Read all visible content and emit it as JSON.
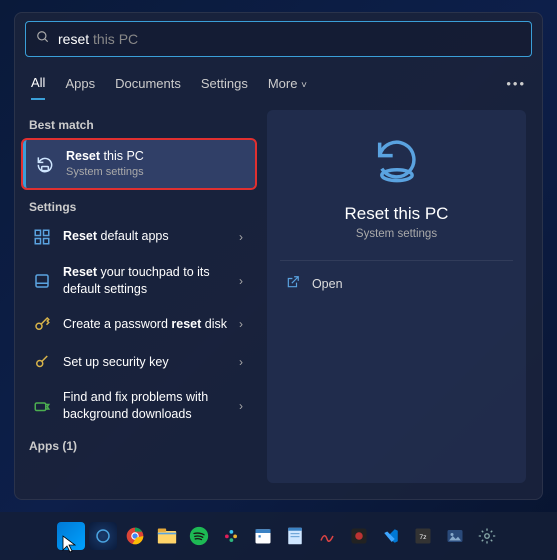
{
  "search": {
    "typed": "reset",
    "suggestion": " this PC"
  },
  "tabs": [
    "All",
    "Apps",
    "Documents",
    "Settings",
    "More"
  ],
  "more_dots": "•••",
  "sections": {
    "best_match": "Best match",
    "settings": "Settings",
    "apps": "Apps (1)"
  },
  "best": {
    "title_bold": "Reset",
    "title_rest": " this PC",
    "subtitle": "System settings"
  },
  "settings_results": [
    {
      "bold": "Reset",
      "rest": " default apps"
    },
    {
      "bold": "Reset",
      "rest": " your touchpad to its default settings"
    },
    {
      "pre": "Create a password ",
      "bold": "reset",
      "rest": " disk"
    },
    {
      "pre": "",
      "bold": "",
      "rest": "Set up security key"
    },
    {
      "pre": "",
      "bold": "",
      "rest": "Find and fix problems with background downloads"
    }
  ],
  "preview": {
    "title": "Reset this PC",
    "subtitle": "System settings",
    "open_label": "Open"
  },
  "colors": {
    "accent": "#3a9fd8",
    "highlight": "#e03030"
  }
}
